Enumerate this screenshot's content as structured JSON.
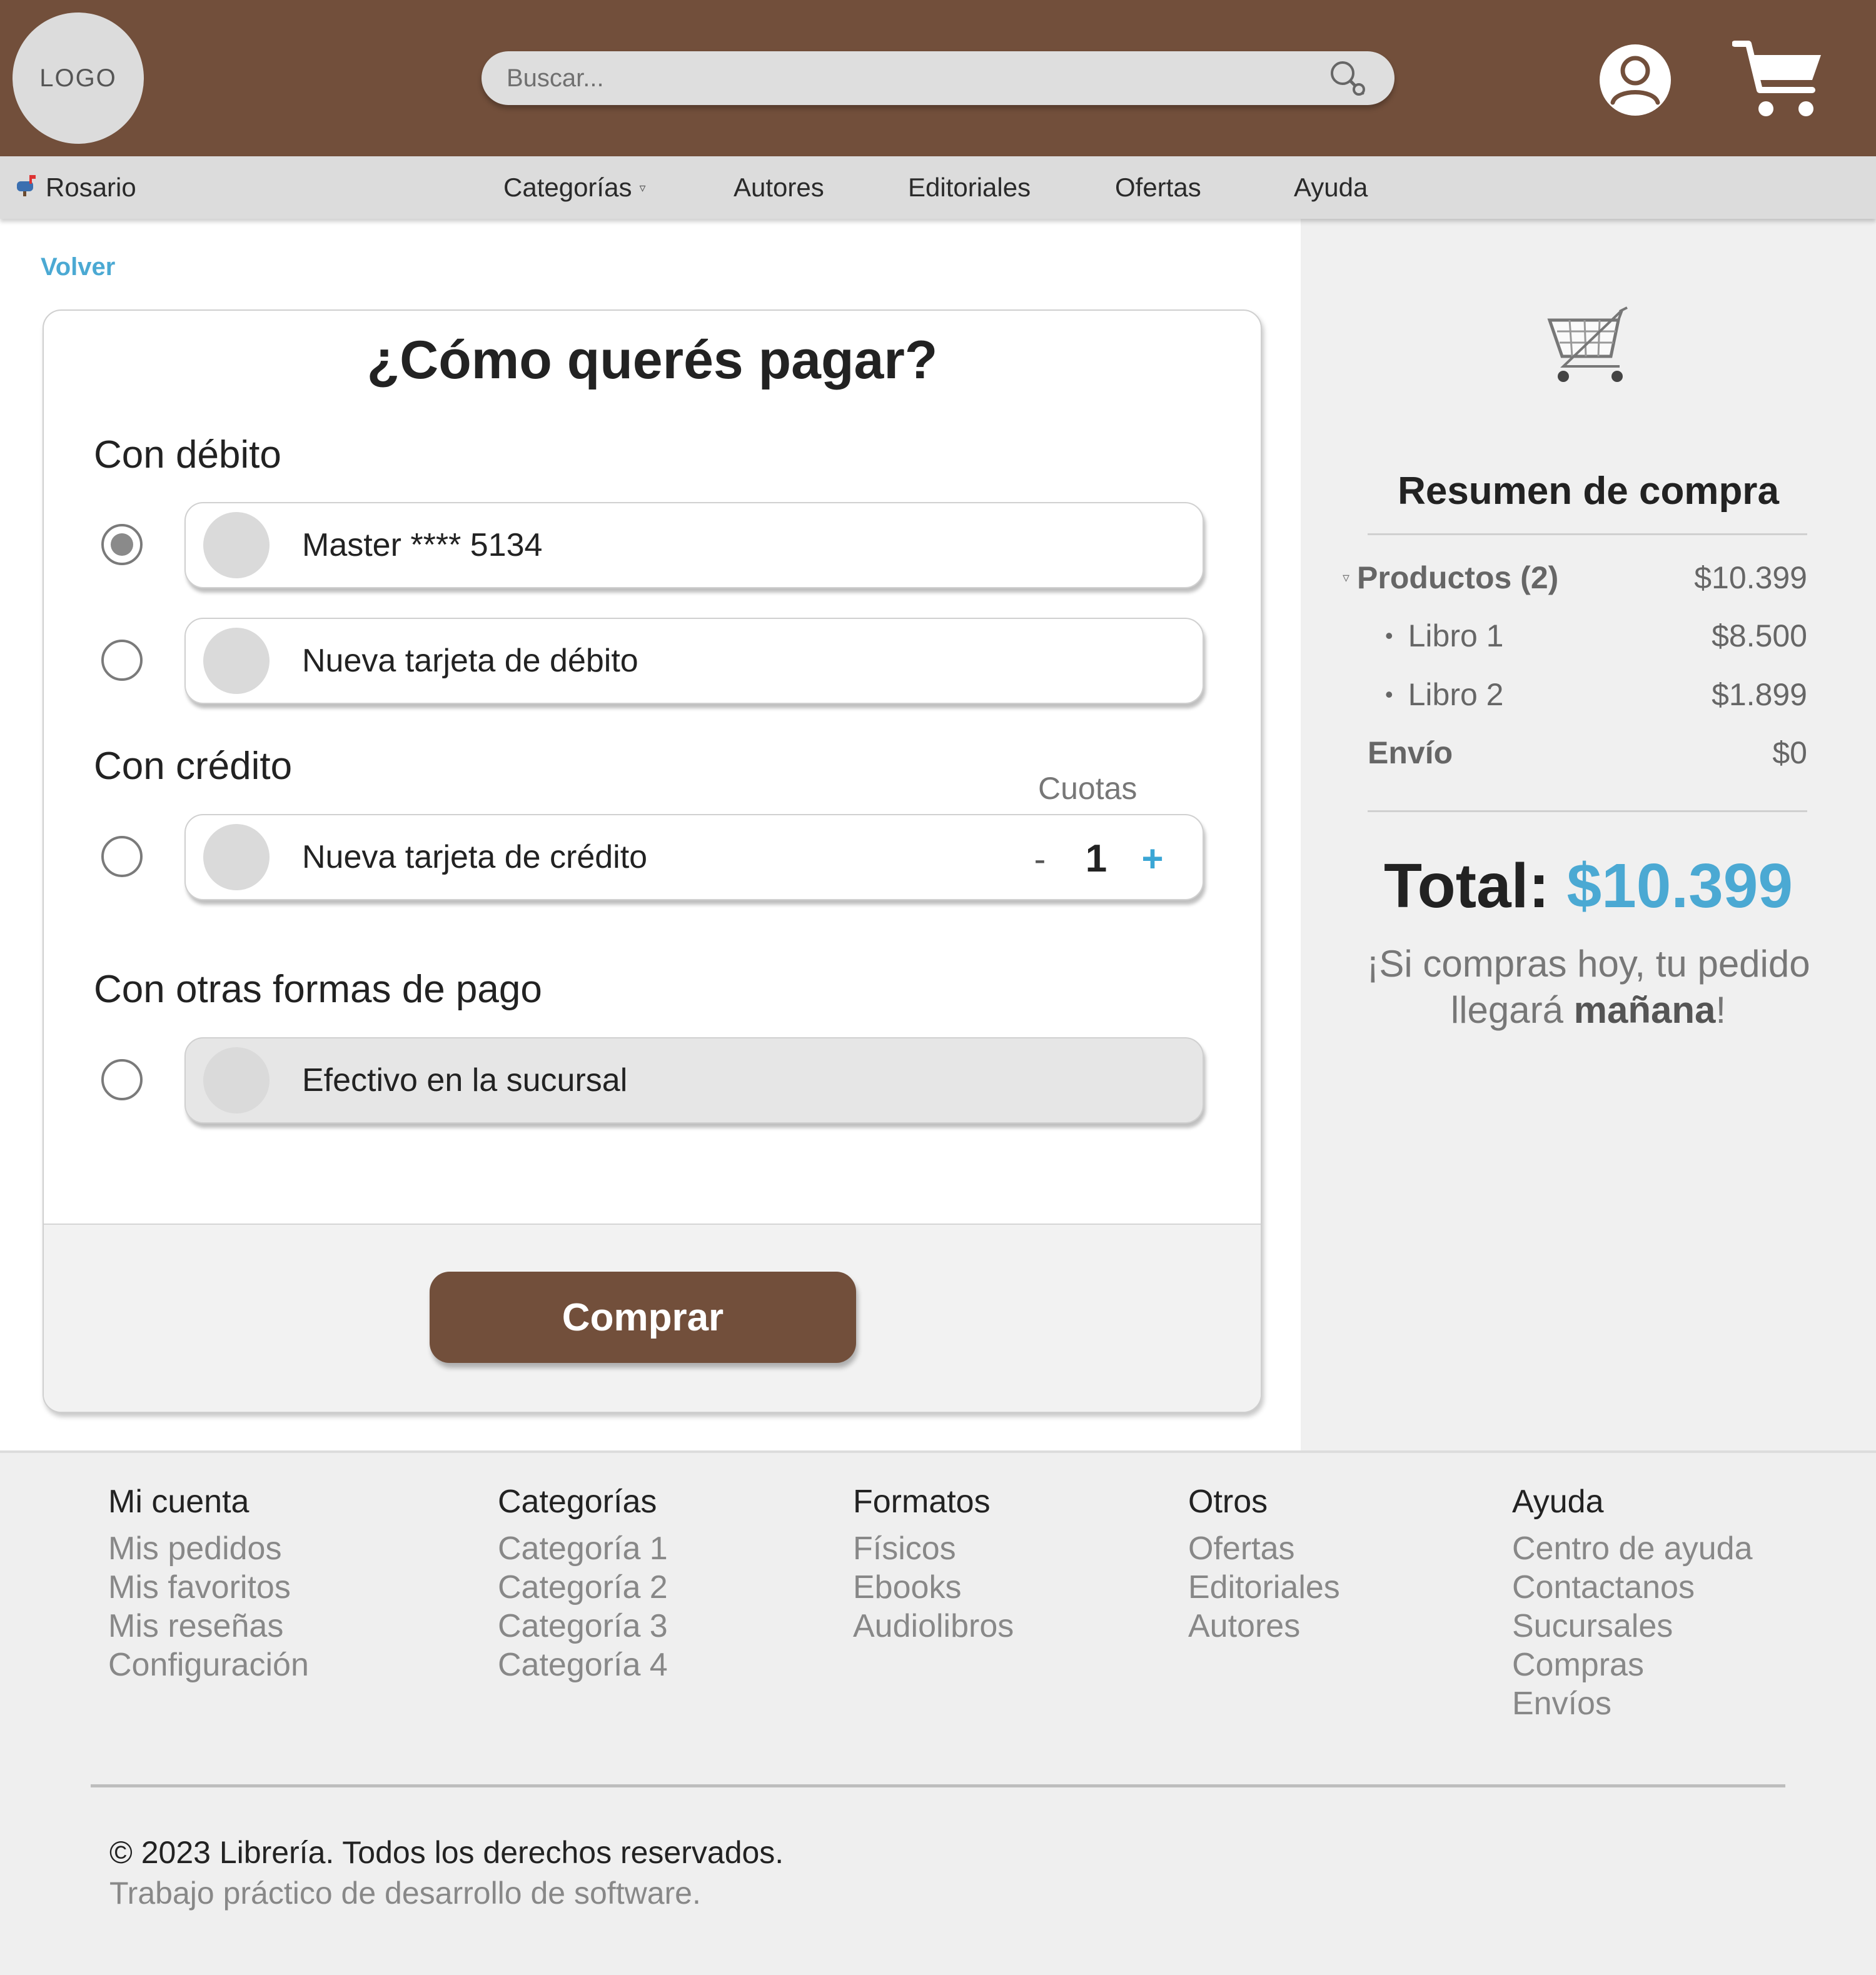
{
  "header": {
    "logo_text": "LOGO",
    "search_placeholder": "Buscar...",
    "brand_color": "#724f3b"
  },
  "nav": {
    "location": "Rosario",
    "location_icon": "mailbox-icon",
    "items": [
      "Categorías",
      "Autores",
      "Editoriales",
      "Ofertas",
      "Ayuda"
    ],
    "dropdown_marker": "▿"
  },
  "checkout": {
    "back_link": "Volver",
    "title": "¿Cómo querés pagar?",
    "debit": {
      "label": "Con débito",
      "options": [
        {
          "label": "Master **** 5134",
          "selected": true
        },
        {
          "label": "Nueva tarjeta de débito",
          "selected": false
        }
      ]
    },
    "credit": {
      "label": "Con crédito",
      "installments_label": "Cuotas",
      "option": {
        "label": "Nueva tarjeta de crédito",
        "selected": false
      },
      "minus": "-",
      "installments_value": "1",
      "plus": "+"
    },
    "other": {
      "label": "Con otras formas de pago",
      "option": {
        "label": "Efectivo en la sucursal",
        "selected": false
      }
    },
    "buy_button": "Comprar"
  },
  "summary": {
    "title": "Resumen de compra",
    "products_label": "Productos (2)",
    "products_total": "$10.399",
    "items": [
      {
        "name": "Libro 1",
        "price": "$8.500"
      },
      {
        "name": "Libro 2",
        "price": "$1.899"
      }
    ],
    "shipping_label": "Envío",
    "shipping_value": "$0",
    "total_label": "Total:",
    "total_value": "$10.399",
    "delivery_text_start": "¡Si compras hoy, tu pedido llegará ",
    "delivery_text_bold": "mañana",
    "delivery_text_end": "!",
    "accent_color": "#4ba9d3"
  },
  "footer": {
    "columns": [
      {
        "title": "Mi cuenta",
        "links": [
          "Mis pedidos",
          "Mis favoritos",
          "Mis reseñas",
          "Configuración"
        ]
      },
      {
        "title": "Categorías",
        "links": [
          "Categoría 1",
          "Categoría 2",
          "Categoría 3",
          "Categoría 4"
        ]
      },
      {
        "title": "Formatos",
        "links": [
          "Físicos",
          "Ebooks",
          "Audiolibros"
        ]
      },
      {
        "title": "Otros",
        "links": [
          "Ofertas",
          "Editoriales",
          "Autores"
        ]
      },
      {
        "title": "Ayuda",
        "links": [
          "Centro de ayuda",
          "Contactanos",
          "Sucursales",
          "Compras",
          "Envíos"
        ]
      }
    ],
    "copyright": "© 2023 Librería. Todos los derechos reservados.",
    "subtitle": "Trabajo práctico de desarrollo de software."
  }
}
